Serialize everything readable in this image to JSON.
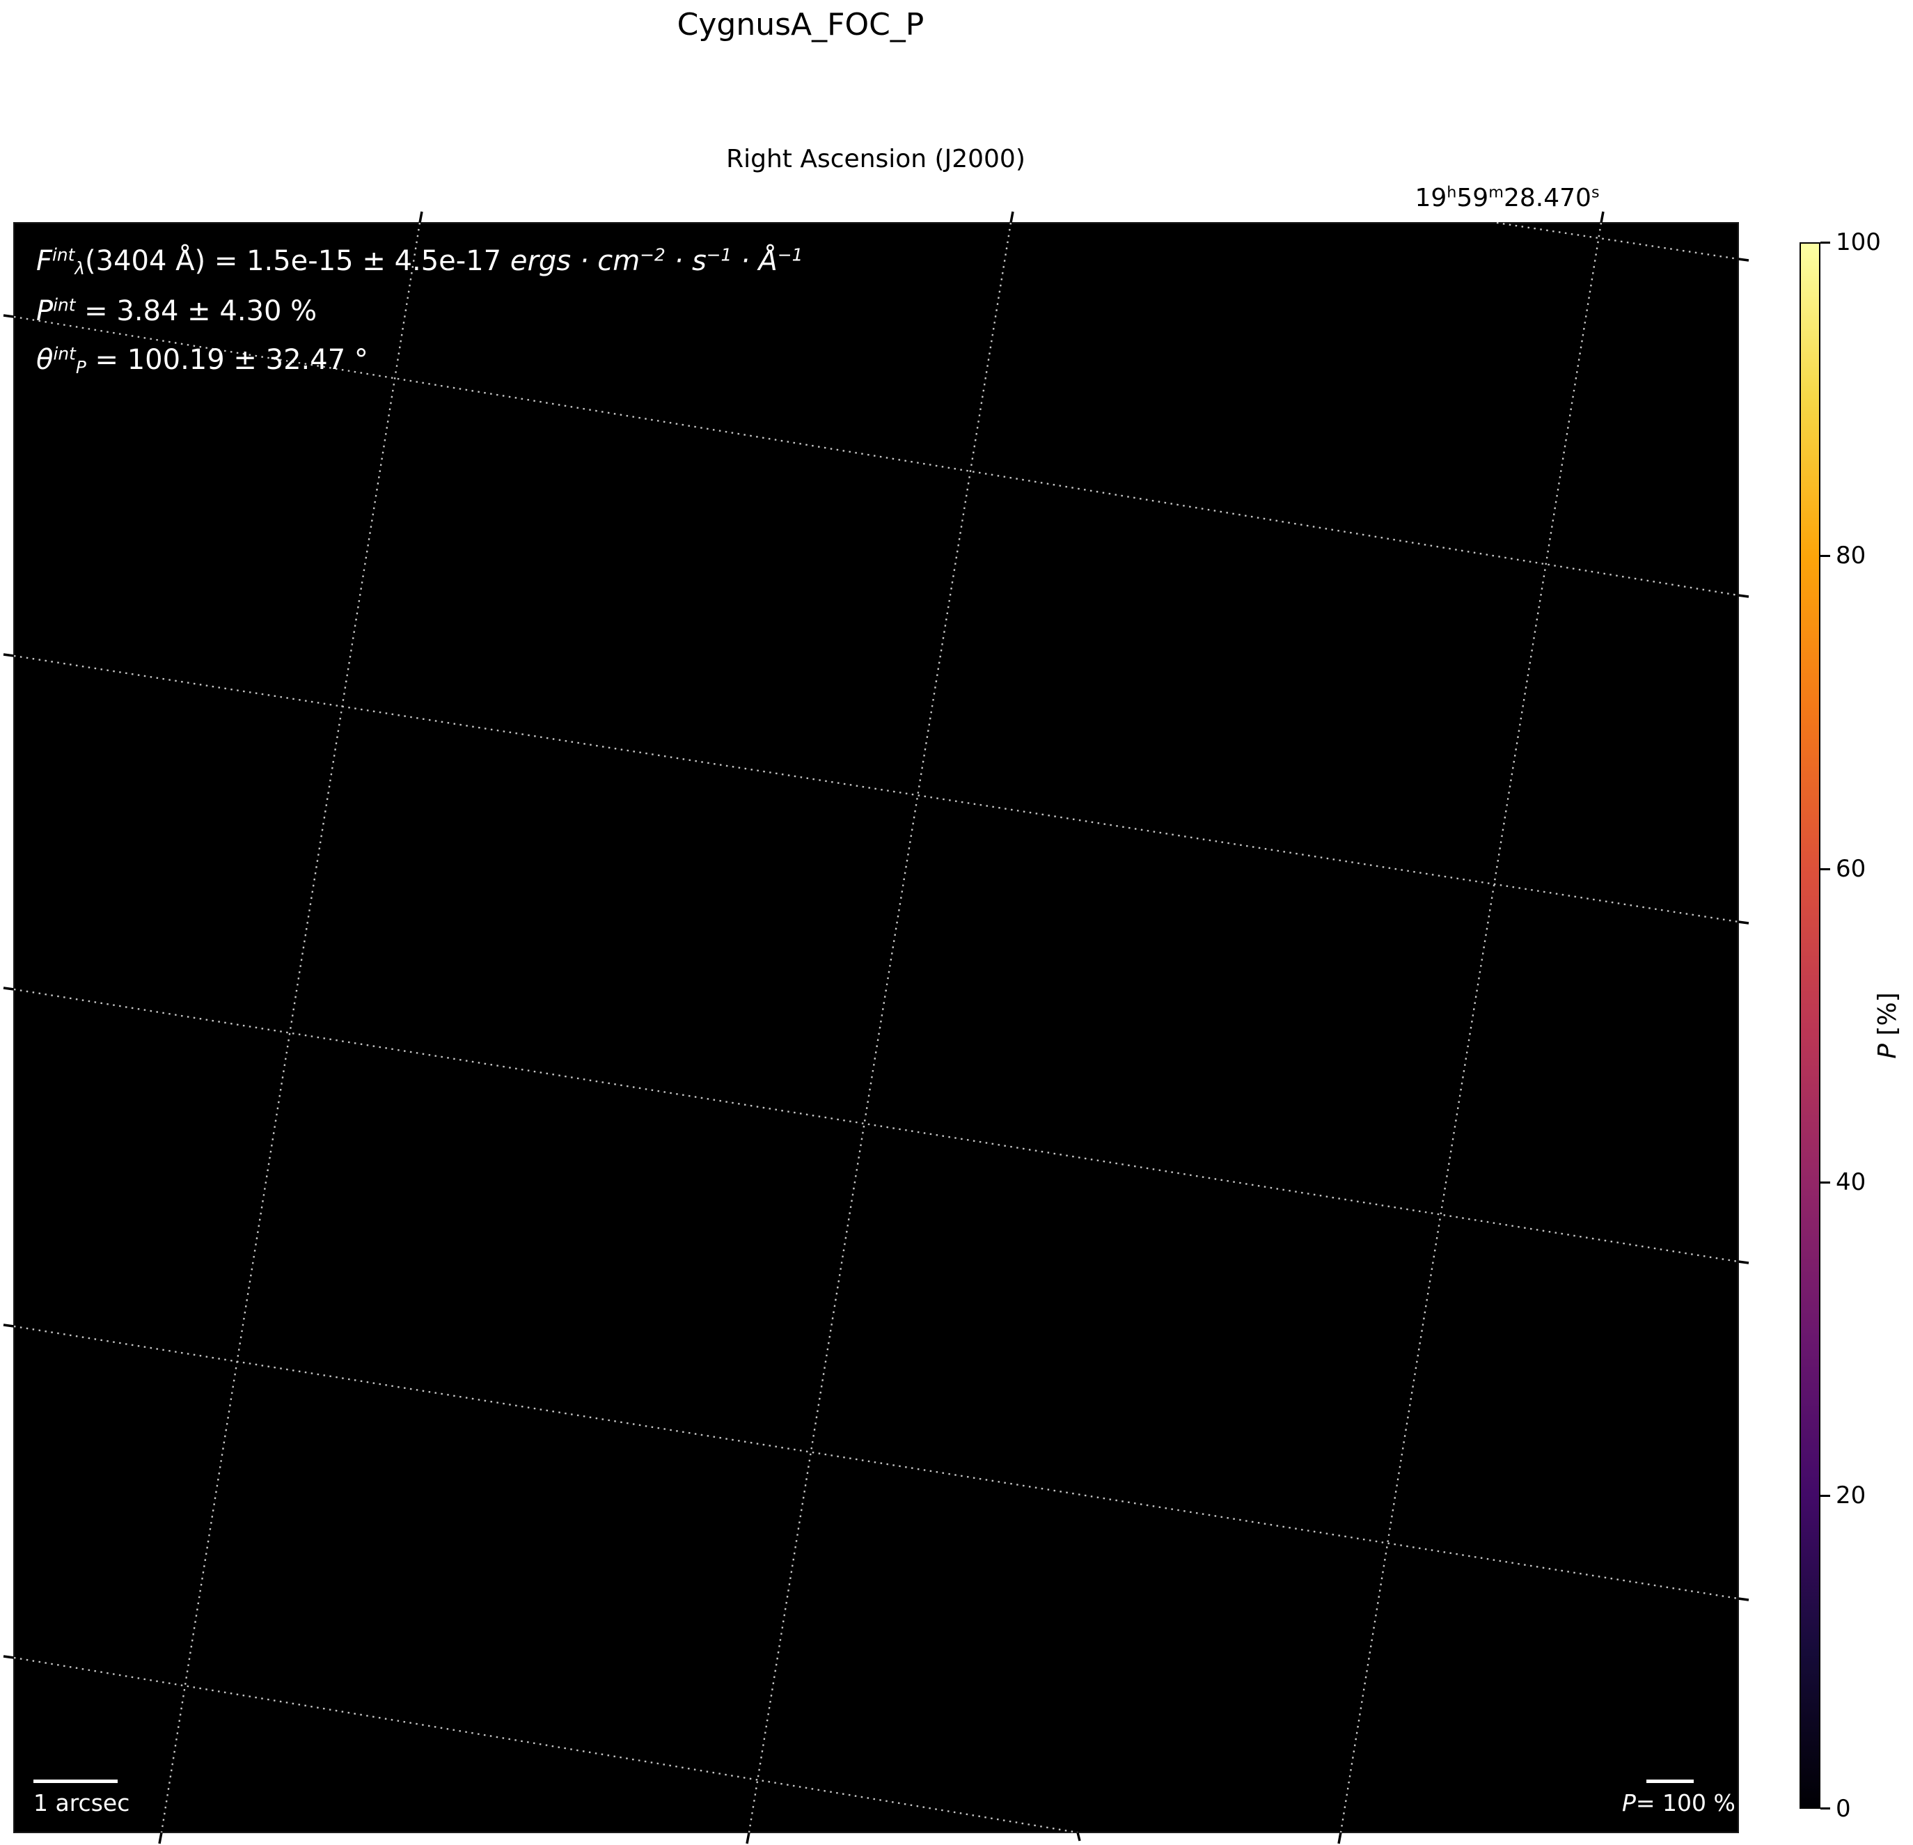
{
  "figure": {
    "title": "CygnusA_FOC_P",
    "background": "#ffffff",
    "plot_background": "#000000"
  },
  "axes": {
    "xlabel_top": "Right Ascension (J2000)",
    "ra_tick": {
      "h_val": "19",
      "h": "h",
      "m_val": "59",
      "m": "m",
      "s_val": "28.470",
      "s": "s"
    }
  },
  "annotation": {
    "line1": {
      "f": "F",
      "f_sup": "int",
      "f_sub": "λ",
      "a": "(3404 Å) = 1.5e-15 ± 4.5e-17 ",
      "u1": "ergs · cm",
      "u1_sup": "−2",
      "u2": " · s",
      "u2_sup": "−1",
      "u3": " · Å",
      "u3_sup": "−1"
    },
    "line2": {
      "p": "P",
      "p_sup": "int",
      "rest": " = 3.84 ± 4.30 %"
    },
    "line3": {
      "t": "θ",
      "t_sup": "int",
      "t_sub": "P",
      "rest": " = 100.19 ± 32.47 °"
    }
  },
  "scalebar": {
    "label": "1 arcsec"
  },
  "pol_ref": {
    "p": "P",
    "rest": "= 100 %"
  },
  "colorbar": {
    "label_p": "P",
    "label_rest": " [%]",
    "ticks": [
      "100",
      "80",
      "60",
      "40",
      "20",
      "0"
    ],
    "gradient": [
      "#fcffa4",
      "#f6d746",
      "#fca50a",
      "#f37819",
      "#dd513a",
      "#bc3754",
      "#932667",
      "#6a176e",
      "#420a68",
      "#160b39",
      "#000004"
    ],
    "grid_color": "#c8c8c8",
    "tick_color": "#000000"
  },
  "chart_data": {
    "type": "heatmap",
    "title": "CygnusA_FOC_P",
    "xlabel": "Right Ascension (J2000)",
    "x_tick_labels": [
      "19h59m28.470s"
    ],
    "colormap": "inferno",
    "colorbar_label": "P [%]",
    "colorbar_range": [
      0,
      100
    ],
    "colorbar_ticks": [
      0,
      20,
      40,
      60,
      80,
      100
    ],
    "image_content": "field rendered entirely black (P ≈ 0 everywhere visible)",
    "integrated_values": {
      "flux_3404A": "1.5e-15 ± 4.5e-17 ergs·cm⁻²·s⁻¹·Å⁻¹",
      "P_int_percent": "3.84 ± 4.30",
      "theta_P_deg": "100.19 ± 32.47"
    },
    "scale_bar": "1 arcsec",
    "polarization_reference": "P= 100 %",
    "grid": true,
    "grid_style": "dotted celestial (WCS) graticule, 3 RA lines + 6 Dec lines"
  }
}
